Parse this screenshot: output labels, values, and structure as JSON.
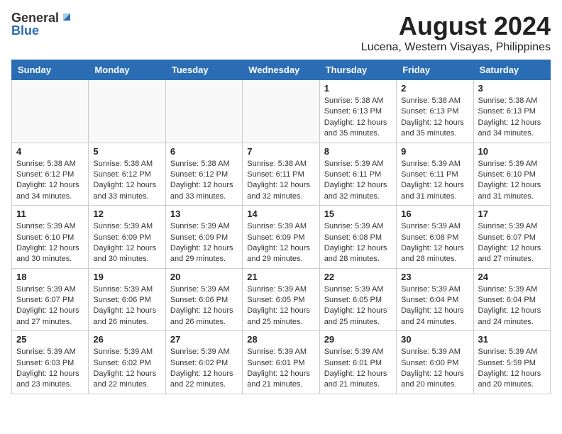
{
  "logo": {
    "general": "General",
    "blue": "Blue",
    "triangle_color": "#2a6db5"
  },
  "title": "August 2024",
  "subtitle": "Lucena, Western Visayas, Philippines",
  "weekdays": [
    "Sunday",
    "Monday",
    "Tuesday",
    "Wednesday",
    "Thursday",
    "Friday",
    "Saturday"
  ],
  "weeks": [
    [
      {
        "day": "",
        "info": ""
      },
      {
        "day": "",
        "info": ""
      },
      {
        "day": "",
        "info": ""
      },
      {
        "day": "",
        "info": ""
      },
      {
        "day": "1",
        "info": "Sunrise: 5:38 AM\nSunset: 6:13 PM\nDaylight: 12 hours\nand 35 minutes."
      },
      {
        "day": "2",
        "info": "Sunrise: 5:38 AM\nSunset: 6:13 PM\nDaylight: 12 hours\nand 35 minutes."
      },
      {
        "day": "3",
        "info": "Sunrise: 5:38 AM\nSunset: 6:13 PM\nDaylight: 12 hours\nand 34 minutes."
      }
    ],
    [
      {
        "day": "4",
        "info": "Sunrise: 5:38 AM\nSunset: 6:12 PM\nDaylight: 12 hours\nand 34 minutes."
      },
      {
        "day": "5",
        "info": "Sunrise: 5:38 AM\nSunset: 6:12 PM\nDaylight: 12 hours\nand 33 minutes."
      },
      {
        "day": "6",
        "info": "Sunrise: 5:38 AM\nSunset: 6:12 PM\nDaylight: 12 hours\nand 33 minutes."
      },
      {
        "day": "7",
        "info": "Sunrise: 5:38 AM\nSunset: 6:11 PM\nDaylight: 12 hours\nand 32 minutes."
      },
      {
        "day": "8",
        "info": "Sunrise: 5:39 AM\nSunset: 6:11 PM\nDaylight: 12 hours\nand 32 minutes."
      },
      {
        "day": "9",
        "info": "Sunrise: 5:39 AM\nSunset: 6:11 PM\nDaylight: 12 hours\nand 31 minutes."
      },
      {
        "day": "10",
        "info": "Sunrise: 5:39 AM\nSunset: 6:10 PM\nDaylight: 12 hours\nand 31 minutes."
      }
    ],
    [
      {
        "day": "11",
        "info": "Sunrise: 5:39 AM\nSunset: 6:10 PM\nDaylight: 12 hours\nand 30 minutes."
      },
      {
        "day": "12",
        "info": "Sunrise: 5:39 AM\nSunset: 6:09 PM\nDaylight: 12 hours\nand 30 minutes."
      },
      {
        "day": "13",
        "info": "Sunrise: 5:39 AM\nSunset: 6:09 PM\nDaylight: 12 hours\nand 29 minutes."
      },
      {
        "day": "14",
        "info": "Sunrise: 5:39 AM\nSunset: 6:09 PM\nDaylight: 12 hours\nand 29 minutes."
      },
      {
        "day": "15",
        "info": "Sunrise: 5:39 AM\nSunset: 6:08 PM\nDaylight: 12 hours\nand 28 minutes."
      },
      {
        "day": "16",
        "info": "Sunrise: 5:39 AM\nSunset: 6:08 PM\nDaylight: 12 hours\nand 28 minutes."
      },
      {
        "day": "17",
        "info": "Sunrise: 5:39 AM\nSunset: 6:07 PM\nDaylight: 12 hours\nand 27 minutes."
      }
    ],
    [
      {
        "day": "18",
        "info": "Sunrise: 5:39 AM\nSunset: 6:07 PM\nDaylight: 12 hours\nand 27 minutes."
      },
      {
        "day": "19",
        "info": "Sunrise: 5:39 AM\nSunset: 6:06 PM\nDaylight: 12 hours\nand 26 minutes."
      },
      {
        "day": "20",
        "info": "Sunrise: 5:39 AM\nSunset: 6:06 PM\nDaylight: 12 hours\nand 26 minutes."
      },
      {
        "day": "21",
        "info": "Sunrise: 5:39 AM\nSunset: 6:05 PM\nDaylight: 12 hours\nand 25 minutes."
      },
      {
        "day": "22",
        "info": "Sunrise: 5:39 AM\nSunset: 6:05 PM\nDaylight: 12 hours\nand 25 minutes."
      },
      {
        "day": "23",
        "info": "Sunrise: 5:39 AM\nSunset: 6:04 PM\nDaylight: 12 hours\nand 24 minutes."
      },
      {
        "day": "24",
        "info": "Sunrise: 5:39 AM\nSunset: 6:04 PM\nDaylight: 12 hours\nand 24 minutes."
      }
    ],
    [
      {
        "day": "25",
        "info": "Sunrise: 5:39 AM\nSunset: 6:03 PM\nDaylight: 12 hours\nand 23 minutes."
      },
      {
        "day": "26",
        "info": "Sunrise: 5:39 AM\nSunset: 6:02 PM\nDaylight: 12 hours\nand 22 minutes."
      },
      {
        "day": "27",
        "info": "Sunrise: 5:39 AM\nSunset: 6:02 PM\nDaylight: 12 hours\nand 22 minutes."
      },
      {
        "day": "28",
        "info": "Sunrise: 5:39 AM\nSunset: 6:01 PM\nDaylight: 12 hours\nand 21 minutes."
      },
      {
        "day": "29",
        "info": "Sunrise: 5:39 AM\nSunset: 6:01 PM\nDaylight: 12 hours\nand 21 minutes."
      },
      {
        "day": "30",
        "info": "Sunrise: 5:39 AM\nSunset: 6:00 PM\nDaylight: 12 hours\nand 20 minutes."
      },
      {
        "day": "31",
        "info": "Sunrise: 5:39 AM\nSunset: 5:59 PM\nDaylight: 12 hours\nand 20 minutes."
      }
    ]
  ]
}
